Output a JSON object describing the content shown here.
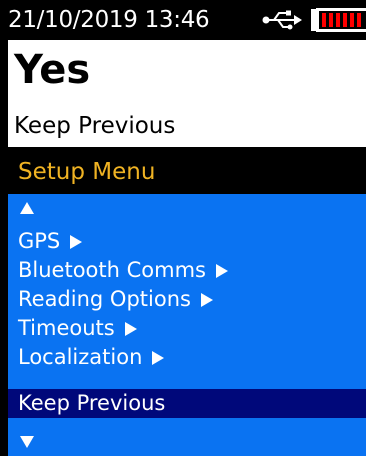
{
  "status_bar": {
    "datetime": "21/10/2019  13:46",
    "usb_icon": "usb-icon",
    "battery_icon": "battery-icon",
    "battery_color": "#ff0000"
  },
  "value": {
    "title": "Yes",
    "subtitle": "Keep Previous"
  },
  "menu": {
    "header": "Setup Menu",
    "header_color": "#f0b323",
    "list_color": "#0a73f2",
    "selected_color": "#00087a",
    "scroll_up_icon": "triangle-up-icon",
    "scroll_down_icon": "triangle-down-icon",
    "items": [
      {
        "label": "GPS",
        "has_submenu": true
      },
      {
        "label": "Bluetooth Comms",
        "has_submenu": true
      },
      {
        "label": "Reading Options",
        "has_submenu": true
      },
      {
        "label": "Timeouts",
        "has_submenu": true
      },
      {
        "label": "Localization",
        "has_submenu": true
      },
      {
        "label": "Keep Previous",
        "has_submenu": false,
        "selected": true
      }
    ]
  }
}
